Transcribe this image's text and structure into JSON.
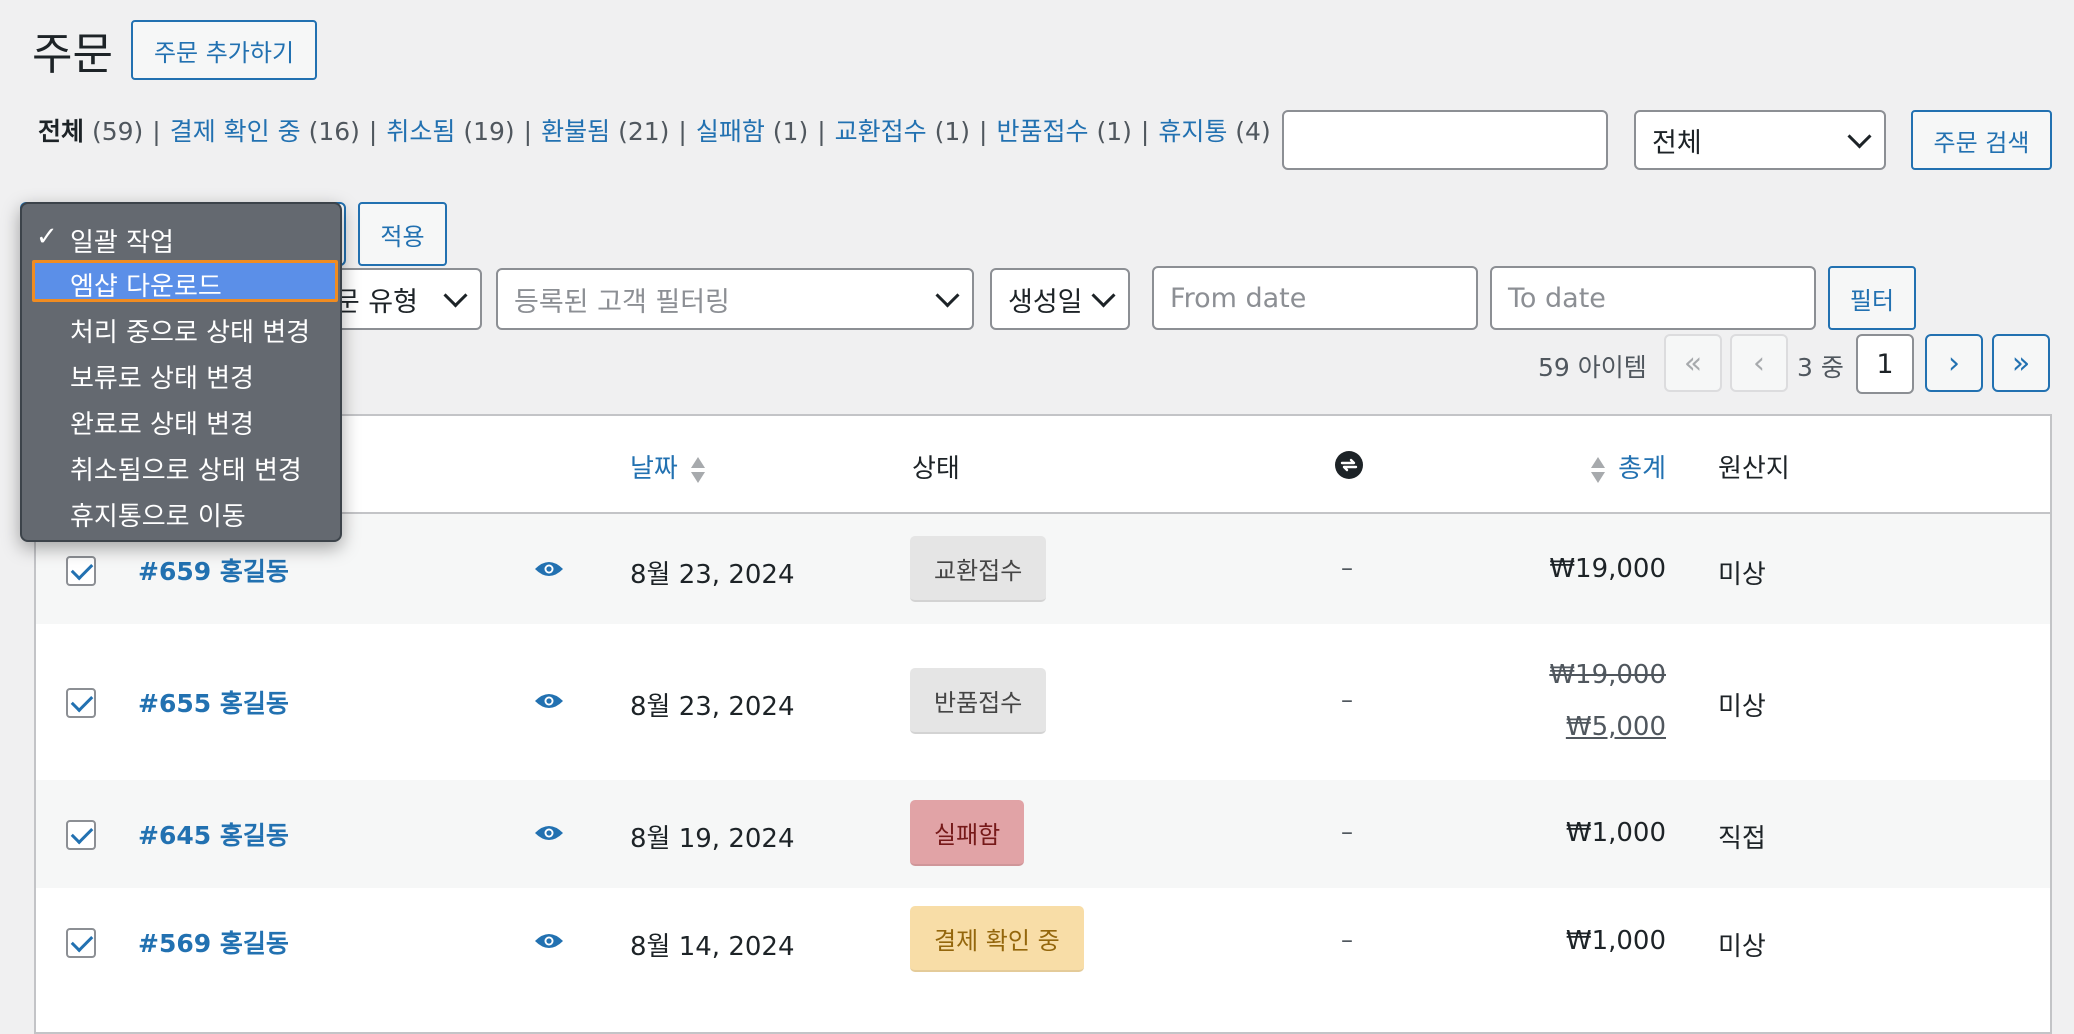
{
  "header": {
    "title": "주문",
    "add_button": "주문 추가하기"
  },
  "status_filters": [
    {
      "label": "전체",
      "count": "(59)",
      "current": true
    },
    {
      "label": "결제 확인 중",
      "count": "(16)"
    },
    {
      "label": "취소됨",
      "count": "(19)"
    },
    {
      "label": "환불됨",
      "count": "(21)"
    },
    {
      "label": "실패함",
      "count": "(1)"
    },
    {
      "label": "교환접수",
      "count": "(1)"
    },
    {
      "label": "반품접수",
      "count": "(1)"
    },
    {
      "label": "휴지통",
      "count": "(4)"
    }
  ],
  "search": {
    "value": "",
    "type_select": "전체",
    "button": "주문 검색"
  },
  "bulk": {
    "apply_button": "적용",
    "options": [
      {
        "label": "일괄 작업",
        "checked": true
      },
      {
        "label": "엠샵 다운로드",
        "highlighted": true
      },
      {
        "label": "처리 중으로 상태 변경"
      },
      {
        "label": "보류로 상태 변경"
      },
      {
        "label": "완료로 상태 변경"
      },
      {
        "label": "취소됨으로 상태 변경"
      },
      {
        "label": "휴지통으로 이동"
      }
    ],
    "check_mark": "✓"
  },
  "filters": {
    "order_type": "주문 유형",
    "customer_placeholder": "등록된 고객 필터링",
    "date_type": "생성일",
    "from_placeholder": "From date",
    "to_placeholder": "To date",
    "filter_button": "필터"
  },
  "pagination": {
    "items": "59 아이템",
    "first": "«",
    "prev": "‹",
    "next": "›",
    "last": "»",
    "total_pages": "3 중",
    "current_page": "1"
  },
  "table": {
    "columns": {
      "date": "날짜",
      "status": "상태",
      "total": "총계",
      "origin": "원산지"
    },
    "rows": [
      {
        "order": "#659 홍길동",
        "date": "8월 23, 2024",
        "status": "교환접수",
        "sync": "–",
        "total": "₩19,000",
        "total_old": "",
        "origin": "미상",
        "status_bg": "#e5e5e5",
        "status_color": "#454545"
      },
      {
        "order": "#655 홍길동",
        "date": "8월 23, 2024",
        "status": "반품접수",
        "sync": "–",
        "total": "₩5,000",
        "total_old": "₩19,000",
        "origin": "미상",
        "status_bg": "#e5e5e5",
        "status_color": "#454545"
      },
      {
        "order": "#645 홍길동",
        "date": "8월 19, 2024",
        "status": "실패함",
        "sync": "–",
        "total": "₩1,000",
        "total_old": "",
        "origin": "직접",
        "status_bg": "#e1a3a6",
        "status_color": "#761919"
      },
      {
        "order": "#569 홍길동",
        "date": "8월 14, 2024",
        "status": "결제 확인 중",
        "sync": "–",
        "total": "₩1,000",
        "total_old": "",
        "origin": "미상",
        "status_bg": "#f8dda7",
        "status_color": "#94660c"
      }
    ]
  },
  "colors": {
    "accent": "#2271b1",
    "background": "#f0f0f1"
  }
}
